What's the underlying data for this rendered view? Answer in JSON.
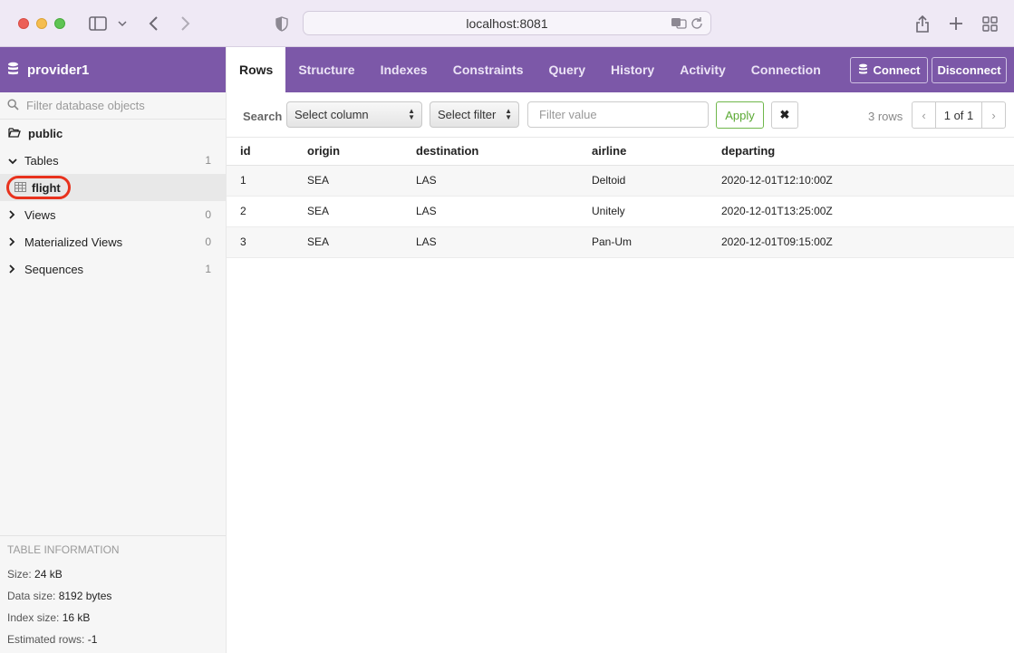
{
  "browser": {
    "url": "localhost:8081"
  },
  "sidebar": {
    "brand": "provider1",
    "filter_placeholder": "Filter database objects",
    "schema": "public",
    "groups": [
      {
        "label": "Tables",
        "count": "1"
      },
      {
        "label": "Views",
        "count": "0"
      },
      {
        "label": "Materialized Views",
        "count": "0"
      },
      {
        "label": "Sequences",
        "count": "1"
      }
    ],
    "tables": [
      {
        "label": "flight"
      }
    ],
    "table_info": {
      "title": "TABLE INFORMATION",
      "rows": [
        {
          "key": "Size:",
          "value": "24 kB"
        },
        {
          "key": "Data size:",
          "value": "8192 bytes"
        },
        {
          "key": "Index size:",
          "value": "16 kB"
        },
        {
          "key": "Estimated rows:",
          "value": "-1"
        }
      ]
    }
  },
  "tabs": [
    "Rows",
    "Structure",
    "Indexes",
    "Constraints",
    "Query",
    "History",
    "Activity",
    "Connection"
  ],
  "actions": {
    "connect": "Connect",
    "disconnect": "Disconnect"
  },
  "search": {
    "label": "Search",
    "column_select": "Select column",
    "filter_select": "Select filter",
    "value_placeholder": "Filter value",
    "apply": "Apply",
    "clear": "✖",
    "rows_count": "3 rows",
    "prev": "‹",
    "page": "1 of 1",
    "next": "›"
  },
  "results": {
    "columns": [
      "id",
      "origin",
      "destination",
      "airline",
      "departing"
    ],
    "rows": [
      [
        "1",
        "SEA",
        "LAS",
        "Deltoid",
        "2020-12-01T12:10:00Z"
      ],
      [
        "2",
        "SEA",
        "LAS",
        "Unitely",
        "2020-12-01T13:25:00Z"
      ],
      [
        "3",
        "SEA",
        "LAS",
        "Pan-Um",
        "2020-12-01T09:15:00Z"
      ]
    ]
  },
  "colors": {
    "accent": "#7c58a8",
    "highlight": "#e8321d",
    "apply_green": "#5aa933"
  }
}
